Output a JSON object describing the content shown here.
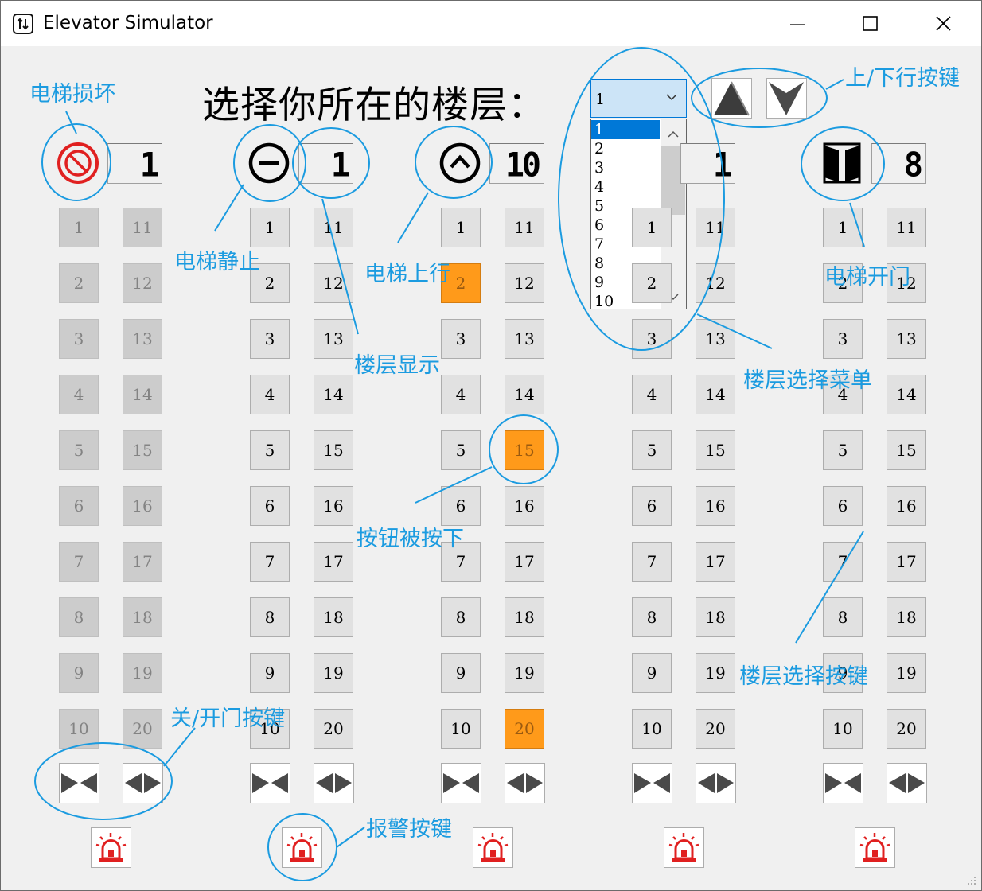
{
  "window": {
    "title": "Elevator Simulator",
    "controls": {
      "minimize": "—",
      "maximize": "☐",
      "close": "✕"
    }
  },
  "heading": "选择你所在的楼层：",
  "floor_select": {
    "selected": "1",
    "options": [
      "1",
      "2",
      "3",
      "4",
      "5",
      "6",
      "7",
      "8",
      "9",
      "10"
    ]
  },
  "direction_buttons": {
    "up": "up-arrow",
    "down": "down-arrow"
  },
  "elevators": [
    {
      "status": "broken",
      "display": "1",
      "disabled": true,
      "pressed": []
    },
    {
      "status": "stopped",
      "display": "1",
      "disabled": false,
      "pressed": []
    },
    {
      "status": "up",
      "display": "10",
      "disabled": false,
      "pressed": [
        "2",
        "15",
        "20"
      ]
    },
    {
      "status": "down",
      "display": "1",
      "disabled": false,
      "pressed": []
    },
    {
      "status": "open",
      "display": "8",
      "disabled": false,
      "pressed": []
    }
  ],
  "floor_buttons": {
    "left": [
      "1",
      "2",
      "3",
      "4",
      "5",
      "6",
      "7",
      "8",
      "9",
      "10"
    ],
    "right": [
      "11",
      "12",
      "13",
      "14",
      "15",
      "16",
      "17",
      "18",
      "19",
      "20"
    ]
  },
  "annotations": {
    "broken": "电梯损坏",
    "stopped": "电梯静止",
    "going_up": "电梯上行",
    "floor_display": "楼层显示",
    "pressed": "按钮被按下",
    "door_buttons": "关/开门按键",
    "alarm": "报警按键",
    "dir_keys": "上/下行按键",
    "menu": "楼层选择菜单",
    "door_open": "电梯开门",
    "floor_keys": "楼层选择按键"
  },
  "colors": {
    "annotation": "#1b9be0",
    "pressed": "#ff9a1a",
    "alarm": "#e02020",
    "accent": "#0078d7"
  }
}
